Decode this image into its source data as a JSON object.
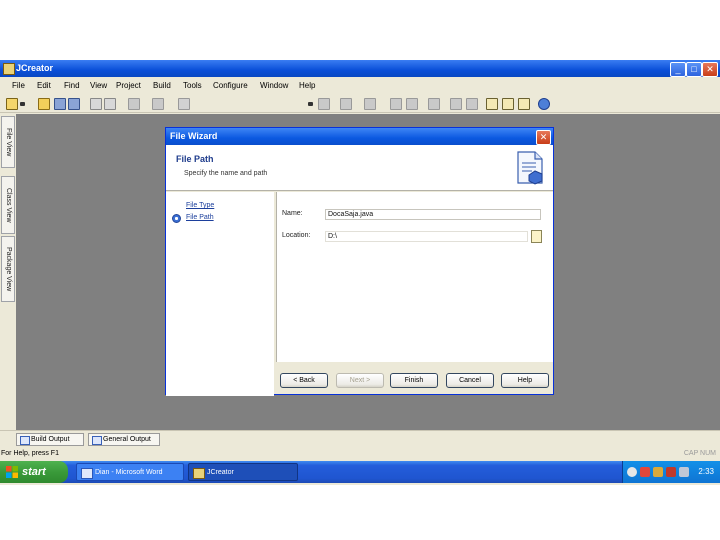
{
  "app": {
    "title": "JCreator",
    "minimize": "_",
    "maximize": "□",
    "close": "✕"
  },
  "menu": [
    "File",
    "Edit",
    "Find",
    "View",
    "Project",
    "Build",
    "Tools",
    "Configure",
    "Window",
    "Help"
  ],
  "left_tabs": [
    "File View",
    "Class View",
    "Package View"
  ],
  "dialog": {
    "title": "File Wizard",
    "close": "✕",
    "header_title": "File Path",
    "header_subtitle": "Specify the name and path",
    "steps": [
      "File Type",
      "File Path"
    ],
    "active_step": "File Path",
    "name_label": "Name:",
    "name_value": "DocaSaja.java",
    "location_label": "Location:",
    "location_value": "D:\\",
    "buttons": {
      "back": "< Back",
      "next": "Next >",
      "finish": "Finish",
      "cancel": "Cancel",
      "help": "Help"
    }
  },
  "output_tabs": [
    "Build Output",
    "General Output"
  ],
  "status": {
    "left": "For Help, press F1",
    "right": "CAP NUM"
  },
  "taskbar": {
    "start": "start",
    "tasks": [
      "Dian - Microsoft Word",
      "JCreator"
    ],
    "clock": "2:33"
  },
  "colors": {
    "xp_blue": "#0a4fd8",
    "workspace_gray": "#808080",
    "dialog_bg": "#ece9d8",
    "start_green": "#3a9a3a"
  }
}
